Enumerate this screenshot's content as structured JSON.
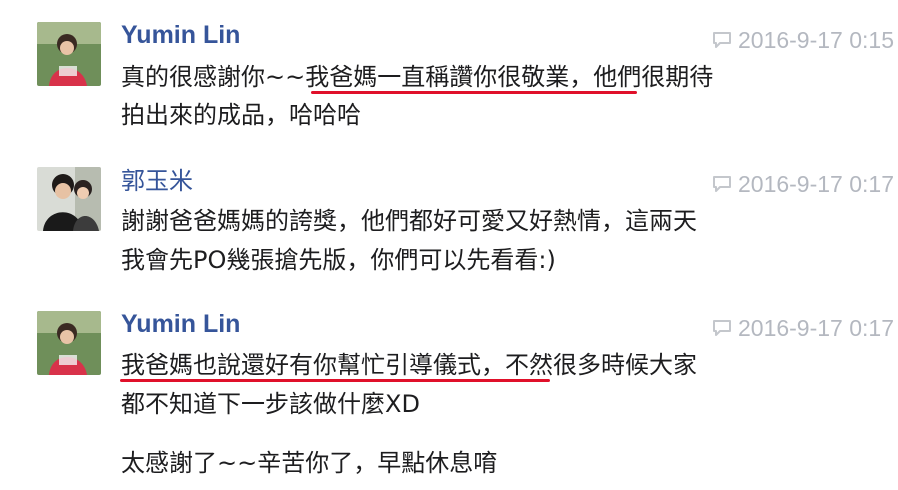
{
  "comments": [
    {
      "author": "Yumin Lin",
      "timestamp": "2016-9-17 0:15",
      "lines": [
        "真的很感謝你~~我爸媽一直稱讚你很敬業，他們很期待",
        "拍出來的成品，哈哈哈"
      ]
    },
    {
      "author": "郭玉米",
      "timestamp": "2016-9-17 0:17",
      "lines": [
        "謝謝爸爸媽媽的誇獎，他們都好可愛又好熱情，這兩天",
        "我會先PO幾張搶先版，你們可以先看看:)"
      ]
    },
    {
      "author": "Yumin Lin",
      "timestamp": "2016-9-17 0:17",
      "lines": [
        "我爸媽也說還好有你幫忙引導儀式，不然很多時候大家",
        "都不知道下一步該做什麼XD",
        "太感謝了~~辛苦你了，早點休息唷"
      ]
    }
  ],
  "highlight_color": "#e0102a",
  "icons": {
    "comment": "speech-bubble-icon",
    "avatar_1": "profile-photo",
    "avatar_2": "profile-photo",
    "avatar_3": "profile-photo"
  }
}
